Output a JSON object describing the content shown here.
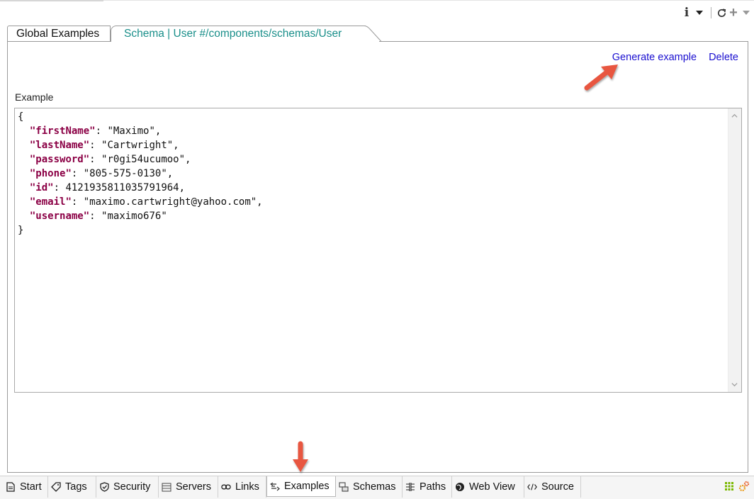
{
  "toolbar": {
    "info_label": "i"
  },
  "tabs": [
    {
      "label": "Global Examples",
      "active": false
    },
    {
      "label": "Schema | User #/components/schemas/User",
      "active": true
    }
  ],
  "actions": {
    "generate_label": "Generate example",
    "delete_label": "Delete"
  },
  "example": {
    "label": "Example",
    "lines": [
      {
        "open": "{"
      },
      {
        "key": "firstName",
        "value": "\"Maximo\","
      },
      {
        "key": "lastName",
        "value": "\"Cartwright\","
      },
      {
        "key": "password",
        "value": "\"r0gi54ucumoo\","
      },
      {
        "key": "phone",
        "value": "\"805-575-0130\","
      },
      {
        "key": "id",
        "value": "4121935811035791964,"
      },
      {
        "key": "email",
        "value": "\"maximo.cartwright@yahoo.com\","
      },
      {
        "key": "username",
        "value": "\"maximo676\""
      },
      {
        "open": "}"
      }
    ]
  },
  "bottom_tabs": [
    {
      "label": "Start",
      "icon": "document-icon"
    },
    {
      "label": "Tags",
      "icon": "tag-icon"
    },
    {
      "label": "Security",
      "icon": "shield-icon"
    },
    {
      "label": "Servers",
      "icon": "server-icon"
    },
    {
      "label": "Links",
      "icon": "link-icon"
    },
    {
      "label": "Examples",
      "icon": "examples-icon",
      "active": true
    },
    {
      "label": "Schemas",
      "icon": "schemas-icon"
    },
    {
      "label": "Paths",
      "icon": "paths-icon"
    },
    {
      "label": "Web View",
      "icon": "globe-icon"
    },
    {
      "label": "Source",
      "icon": "code-icon"
    }
  ],
  "colors": {
    "link": "#1a0fd0",
    "tab_active_text": "#1a8f8a",
    "json_key": "#8b0045",
    "arrow": "#e8563f"
  }
}
